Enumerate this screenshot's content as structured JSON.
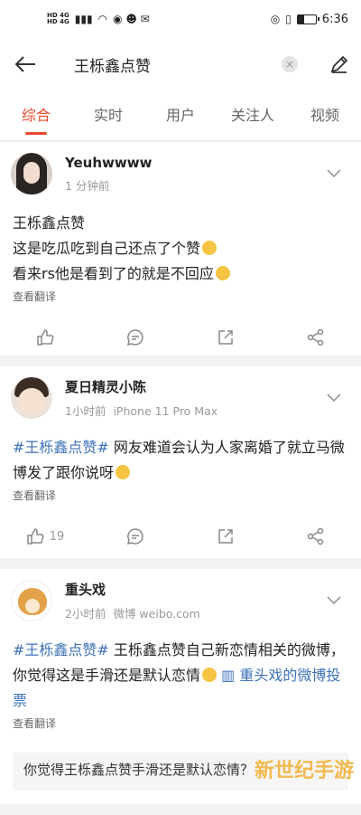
{
  "status": {
    "time": "6:36",
    "left_tags": [
      "HD",
      "4G",
      "HD",
      "4G"
    ]
  },
  "search": {
    "query": "王栎鑫点赞"
  },
  "tabs": [
    "综合",
    "实时",
    "用户",
    "关注人",
    "视频"
  ],
  "posts": [
    {
      "name": "Yeuhwwww",
      "time": "1 分钟前",
      "source": "",
      "lines": [
        "王栎鑫点赞",
        "这是吃瓜吃到自己还点了个赞",
        "看来rs他是看到了的就是不回应"
      ],
      "translate": "查看翻译",
      "likes": ""
    },
    {
      "name": "夏日精灵小陈",
      "time": "1小时前",
      "source": "iPhone 11 Pro Max",
      "hashtag": "#王栎鑫点赞#",
      "text": " 网友难道会认为人家离婚了就立马微博发了跟你说呀",
      "translate": "查看翻译",
      "likes": "19"
    },
    {
      "name": "重头戏",
      "time": "2小时前",
      "source": "微博 weibo.com",
      "hashtag": "#王栎鑫点赞#",
      "text": " 王栎鑫点赞自己新恋情相关的微博，你觉得这是手滑还是默认恋情",
      "poll_link": "重头戏的微博投票",
      "translate": "查看翻译",
      "poll_question": "你觉得王栎鑫点赞手滑还是默认恋情？"
    }
  ],
  "watermark": "新世纪手游",
  "colors": {
    "accent": "#e8492e",
    "link": "#3d72b8"
  }
}
